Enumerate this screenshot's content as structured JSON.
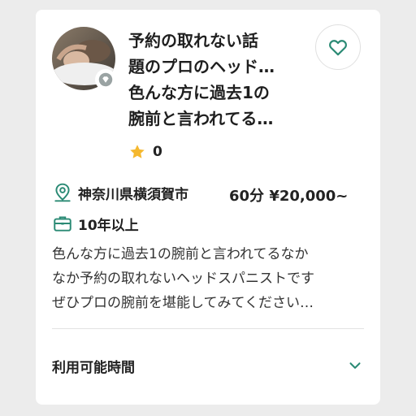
{
  "card": {
    "title_lines": [
      "予約の取れない話",
      "題のプロのヘッド…",
      "色んな方に過去1の",
      "腕前と言われてる…"
    ],
    "rating": {
      "icon": "star-icon",
      "count": "0",
      "star_color": "#f5b82e"
    },
    "location": {
      "icon": "map-pin-icon",
      "text": "神奈川県横須賀市"
    },
    "price": "60分 ¥20,000~",
    "experience": {
      "icon": "briefcase-icon",
      "text": "10年以上"
    },
    "description_lines": [
      "色んな方に過去1の腕前と言われてるなか",
      "なか予約の取れないヘッドスパニストです",
      "ぜひプロの腕前を堪能してみてください…"
    ],
    "availability": {
      "label": "利用可能時間",
      "icon": "chevron-down-icon"
    },
    "favorite_icon": "heart-icon",
    "avatar_badge_icon": "diamond-icon",
    "accent_color": "#2a8a74"
  }
}
